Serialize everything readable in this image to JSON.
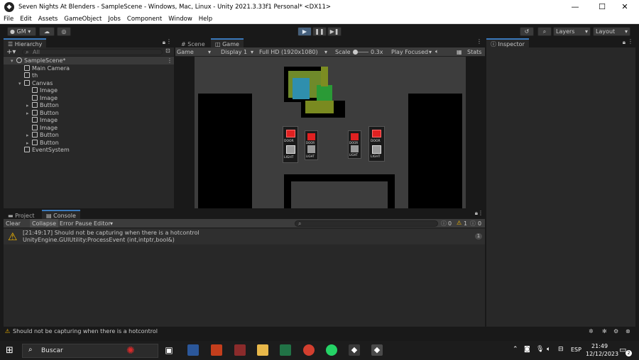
{
  "window": {
    "title": "Seven Nights At Blenders - SampleScene - Windows, Mac, Linux - Unity 2021.3.33f1 Personal* <DX11>",
    "controls": {
      "minimize": "—",
      "maximize": "☐",
      "close": "✕"
    }
  },
  "menu": [
    "File",
    "Edit",
    "Assets",
    "GameObject",
    "Jobs",
    "Component",
    "Window",
    "Help"
  ],
  "toolbar": {
    "account": "GM",
    "layers": "Layers",
    "layout": "Layout"
  },
  "hierarchy": {
    "tab": "Hierarchy",
    "search_placeholder": "All",
    "items": [
      {
        "label": "SampleScene*",
        "depth": 0,
        "expanded": true,
        "scene": true
      },
      {
        "label": "Main Camera",
        "depth": 1
      },
      {
        "label": "th",
        "depth": 1
      },
      {
        "label": "Canvas",
        "depth": 1,
        "expanded": true
      },
      {
        "label": "Image",
        "depth": 2
      },
      {
        "label": "Image",
        "depth": 2
      },
      {
        "label": "Button",
        "depth": 2,
        "collapsed": true
      },
      {
        "label": "Button",
        "depth": 2,
        "collapsed": true
      },
      {
        "label": "Image",
        "depth": 2
      },
      {
        "label": "Image",
        "depth": 2
      },
      {
        "label": "Button",
        "depth": 2,
        "collapsed": true
      },
      {
        "label": "Button",
        "depth": 2,
        "collapsed": true
      },
      {
        "label": "EventSystem",
        "depth": 1
      }
    ]
  },
  "scene_tabs": {
    "scene": "Scene",
    "game": "Game"
  },
  "game_bar": {
    "display_mode": "Game",
    "display": "Display 1",
    "resolution": "Full HD (1920x1080)",
    "scale_label": "Scale",
    "scale_value": "0.3x",
    "play_mode": "Play Focused",
    "stats": "Stats"
  },
  "game_scene": {
    "door_label": "DOOR",
    "light_label": "LIGHT"
  },
  "inspector": {
    "tab": "Inspector"
  },
  "bottom_tabs": {
    "project": "Project",
    "console": "Console"
  },
  "console_bar": {
    "clear": "Clear",
    "collapse": "Collapse",
    "error_pause": "Error Pause",
    "editor": "Editor",
    "counts": {
      "info": "0",
      "warning": "1",
      "error": "0"
    }
  },
  "console_entries": [
    {
      "line1": "[21:49:17] Should not be capturing when there is a hotcontrol",
      "line2": "UnityEngine.GUIUtility:ProcessEvent (int,intptr,bool&)",
      "count": "1"
    }
  ],
  "status_message": "Should not be capturing when there is a hotcontrol",
  "taskbar": {
    "search": "Buscar",
    "language": "ESP",
    "time": "21:49",
    "date": "12/12/2023",
    "notification_count": "2"
  },
  "colors": {
    "accent": "#3a79bb",
    "warning": "#f5b800",
    "panel": "#282828",
    "game_bg": "#3d3d3d"
  }
}
